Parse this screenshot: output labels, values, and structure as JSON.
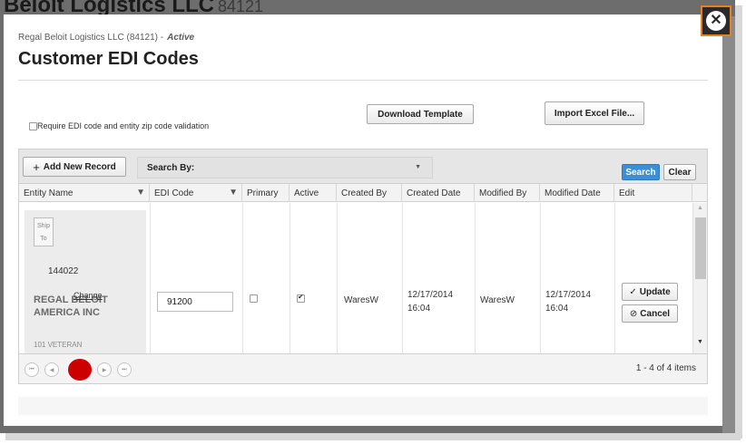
{
  "background": {
    "title": "Beloit Logistics LLC",
    "title_num": "84121"
  },
  "modal": {
    "subtitle": "Regal Beloit Logistics LLC (84121) -",
    "status": "Active",
    "title": "Customer EDI Codes"
  },
  "validation": {
    "checkbox_label": "Require EDI code and entity zip code validation",
    "checked": false
  },
  "actions": {
    "download_template": "Download Template",
    "import_excel": "Import Excel File..."
  },
  "toolbar": {
    "add_new_record": "Add New Record",
    "search_by": "Search By:",
    "search": "Search",
    "clear": "Clear"
  },
  "columns": [
    "Entity Name",
    "EDI Code",
    "Primary",
    "Active",
    "Created By",
    "Created Date",
    "Modified By",
    "Modified Date",
    "Edit"
  ],
  "row": {
    "ship_to": "Ship To",
    "entity_code": "144022",
    "entity_name": "REGAL BELOIT AMERICA INC",
    "change_link": "Change",
    "address": "101 VETERAN",
    "edi_code": "91200",
    "primary": false,
    "active": true,
    "created_by": "WaresW",
    "created_date": "12/17/2014",
    "created_time": "16:04",
    "modified_by": "WaresW",
    "modified_date": "12/17/2014",
    "modified_time": "16:04",
    "update": "Update",
    "cancel": "Cancel"
  },
  "pager": {
    "info": "1 - 4 of 4 items",
    "current_page": "1"
  },
  "colors": {
    "accent_blue": "#3a8fd6",
    "close_border": "#e8801e",
    "current_page": "#cc0000"
  }
}
